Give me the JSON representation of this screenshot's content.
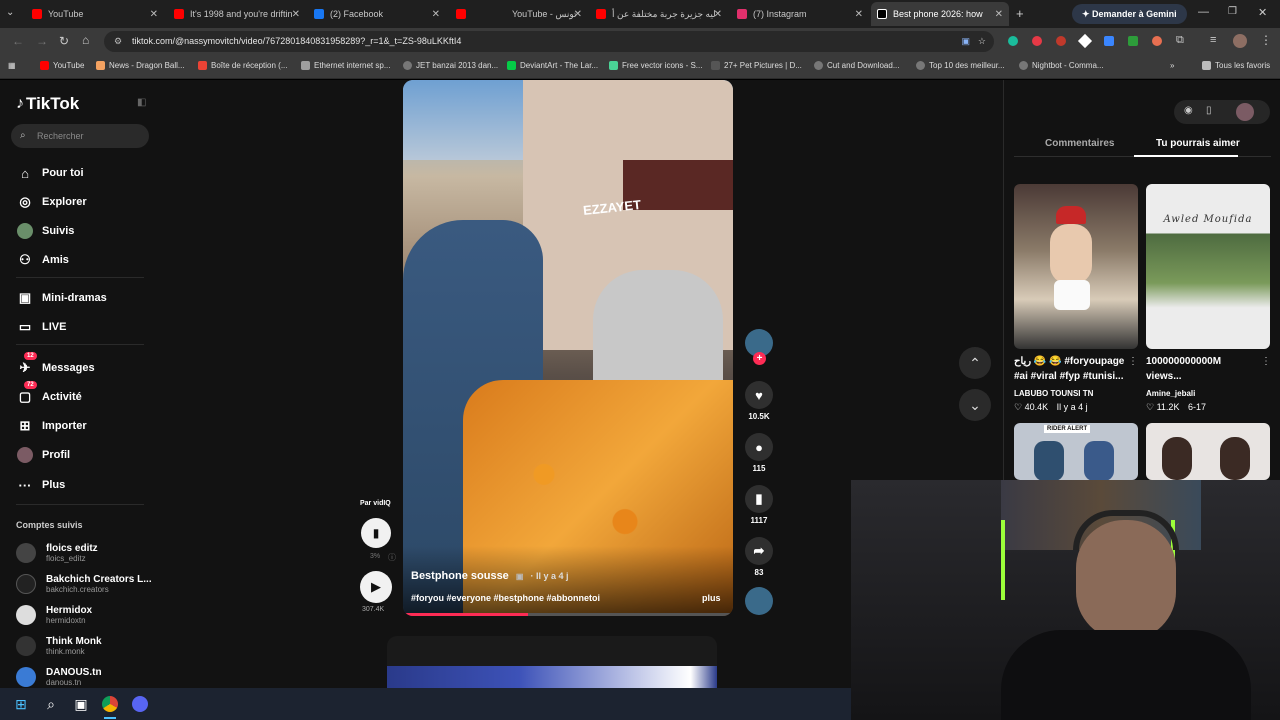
{
  "browser": {
    "tabs": [
      {
        "title": "YouTube",
        "color": "#ff0000"
      },
      {
        "title": "It's 1998 and you're driftin",
        "color": "#ff0000"
      },
      {
        "title": "(2) Facebook",
        "color": "#1877f2"
      },
      {
        "title": "YouTube - تونس",
        "color": "#ff0000"
      },
      {
        "title": "ليه جزيرة جربة مختلفة عن أ",
        "color": "#ff0000"
      },
      {
        "title": "(7) Instagram",
        "color": "#e1306c"
      },
      {
        "title": "Best phone 2026: how",
        "color": "#ffffff"
      }
    ],
    "gemini_button": "Demander à Gemini",
    "url": "tiktok.com/@nassymovitch/video/7672801840831958289?_r=1&_t=ZS-98uLKKftI4",
    "bookmarks": [
      "YouTube",
      "News - Dragon Ball...",
      "Boîte de réception (...",
      "Ethernet internet sp...",
      "JET banzai 2013 dan...",
      "DeviantArt - The Lar...",
      "Free vector icons - S...",
      "27+ Pet Pictures | D...",
      "Cut and Download...",
      "Top 10 des meilleur...",
      "Nightbot - Comma..."
    ],
    "all_bookmarks": "Tous les favoris"
  },
  "tiktok": {
    "logo": "TikTok",
    "search_placeholder": "Rechercher",
    "nav": [
      {
        "label": "Pour toi",
        "icon": "home-icon"
      },
      {
        "label": "Explorer",
        "icon": "compass-icon"
      },
      {
        "label": "Suivis",
        "icon": "following-icon"
      },
      {
        "label": "Amis",
        "icon": "friends-icon"
      },
      {
        "label": "Mini-dramas",
        "icon": "drama-icon"
      },
      {
        "label": "LIVE",
        "icon": "live-icon"
      },
      {
        "label": "Messages",
        "icon": "messages-icon",
        "badge": "12"
      },
      {
        "label": "Activité",
        "icon": "activity-icon",
        "badge": "72"
      },
      {
        "label": "Importer",
        "icon": "upload-icon"
      },
      {
        "label": "Profil",
        "icon": "profile-icon"
      },
      {
        "label": "Plus",
        "icon": "more-icon"
      }
    ],
    "followed_title": "Comptes suivis",
    "followed": [
      {
        "name": "floics editz",
        "handle": "floics_editz"
      },
      {
        "name": "Bakchich Creators L...",
        "handle": "bakchich.creators"
      },
      {
        "name": "Hermidox",
        "handle": "hermidoxtn"
      },
      {
        "name": "Think Monk",
        "handle": "think.monk"
      },
      {
        "name": "DANOUS.tn",
        "handle": "danous.tn"
      }
    ]
  },
  "video": {
    "author": "Bestphone sousse",
    "time": "· Il y a 4 j",
    "hashtags": "#foryou #everyone #bestphone #abbonnetoi",
    "more": "plus",
    "shop_sign": "EZZAYET",
    "progress": 0.38,
    "likes": "10.5K",
    "comments": "115",
    "saves": "1117",
    "shares": "83",
    "side_label": "Par vidIQ",
    "side_percent": "3%",
    "side_views": "307.4K"
  },
  "right": {
    "tab_comments": "Commentaires",
    "tab_suggest": "Tu pourrais aimer",
    "items": [
      {
        "caption_line1": "رياح 😂 😂 #foryoupage",
        "caption_line2": "#ai #viral #fyp #tunisi...",
        "user": "LABUBO TOUNSI TN",
        "likes": "40.4K",
        "date": "Il y a 4 j"
      },
      {
        "caption_line1": "100000000000M",
        "caption_line2": "views...",
        "user": "Amine_jebali",
        "likes": "11.2K",
        "date": "6-17",
        "thumb_text": "Awled Moufida"
      }
    ],
    "second_row_banner": "RIDER ALERT"
  }
}
